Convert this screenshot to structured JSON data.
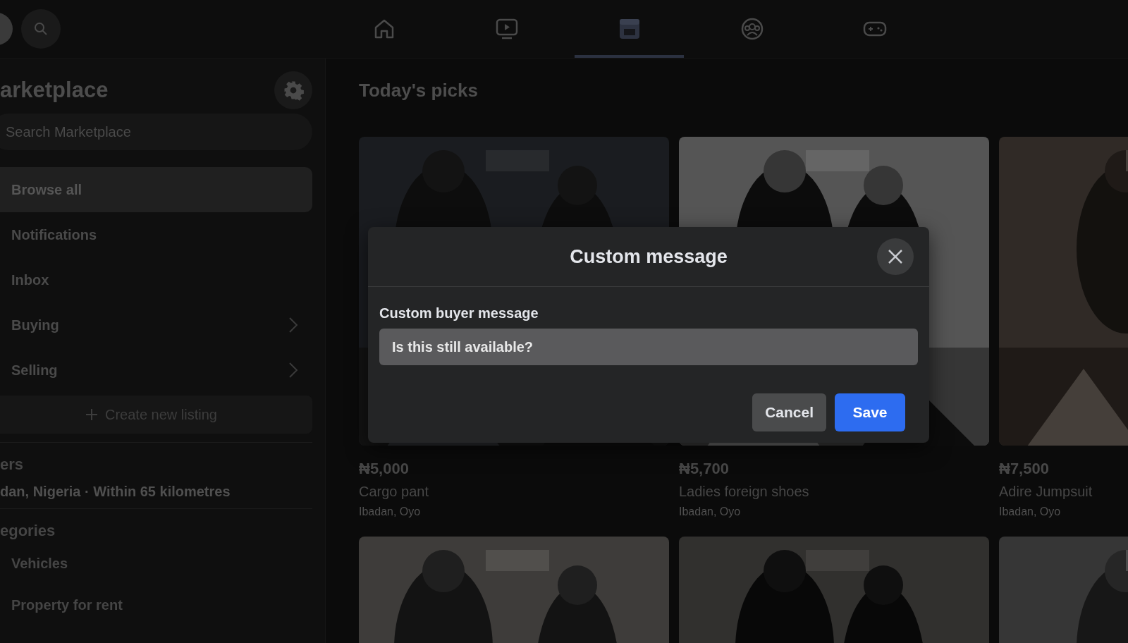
{
  "top_bar": {
    "nav": [
      {
        "kind": "home",
        "selected": false
      },
      {
        "kind": "video",
        "selected": false
      },
      {
        "kind": "marketplace",
        "selected": true
      },
      {
        "kind": "groups",
        "selected": false
      },
      {
        "kind": "gaming",
        "selected": false
      }
    ]
  },
  "sidebar": {
    "title": "arketplace",
    "search": {
      "placeholder": "Search Marketplace"
    },
    "items": [
      {
        "label": "Browse all",
        "selected": true,
        "has_submenu": false
      },
      {
        "label": "Notifications",
        "selected": false,
        "has_submenu": false
      },
      {
        "label": "Inbox",
        "selected": false,
        "has_submenu": false
      },
      {
        "label": "Buying",
        "selected": false,
        "has_submenu": true
      },
      {
        "label": "Selling",
        "selected": false,
        "has_submenu": true
      }
    ],
    "create_button": "Create new listing",
    "filters_heading": "ers",
    "location": "dan, Nigeria · Within 65 kilometres",
    "categories_heading": "egories",
    "categories": [
      "Vehicles",
      "Property for rent"
    ]
  },
  "main": {
    "heading": "Today's picks",
    "listings": [
      {
        "price": "₦5,000",
        "title": "Cargo pant",
        "location": "Ibadan, Oyo"
      },
      {
        "price": "₦5,700",
        "title": "Ladies foreign shoes",
        "location": "Ibadan, Oyo"
      },
      {
        "price": "₦7,500",
        "title": "Adire Jumpsuit",
        "location": "Ibadan, Oyo"
      }
    ]
  },
  "dialog": {
    "title": "Custom message",
    "field_label": "Custom buyer message",
    "value": "Is this still available?",
    "buttons": [
      {
        "label": "Cancel",
        "kind": "secondary"
      },
      {
        "label": "Save",
        "kind": "primary"
      }
    ]
  }
}
